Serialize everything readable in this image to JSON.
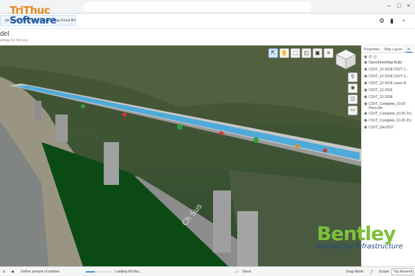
{
  "logo": {
    "line1": "TriThuc",
    "line2": "Software"
  },
  "tab_strip_text": "ple Model   Point Cloud Imagery   Map   Drone   Bridge",
  "page": {
    "title": "del",
    "subtitle": "ettings for this tool"
  },
  "viewport_tools": [
    {
      "icon": "select-icon",
      "glyph": "⇱",
      "active": true
    },
    {
      "icon": "pan-icon",
      "glyph": "✋",
      "active": false
    },
    {
      "icon": "fit-view-icon",
      "glyph": "⬚",
      "active": false
    },
    {
      "icon": "window-area-icon",
      "glyph": "◰",
      "active": false
    },
    {
      "icon": "image-icon",
      "glyph": "▣",
      "active": false
    },
    {
      "icon": "list-icon",
      "glyph": "≡",
      "active": false
    }
  ],
  "side_tools": [
    {
      "icon": "walk-icon",
      "glyph": "⚲"
    },
    {
      "icon": "camera-icon",
      "glyph": "◉"
    },
    {
      "icon": "measure-icon",
      "glyph": "◫"
    },
    {
      "icon": "fullscreen-icon",
      "glyph": "▭"
    }
  ],
  "panel": {
    "tabs": [
      "Properties",
      "Map Layers",
      "M"
    ],
    "layers": [
      "OpenStreetMap Build",
      "CSVT_12-2018 CSVT-1...",
      "CSVT_12-2018 CSVT-1...",
      "CSVT_12-2018 Lower B",
      "CSVT_12-2016",
      "CSVT_12-2018",
      "CSVT_Complete_10-20 Piers-dm",
      "CSVT_Complete_10-20 21c",
      "CSVT_Complete_10-20 21c",
      "CSVT_Dec2017"
    ]
  },
  "status": {
    "help": "Define amount of rotation",
    "loading": "Loading 68 tiles...",
    "views": "Views",
    "snap": "Snap Mode",
    "scope_label": "Scope:",
    "scope_value": "Top Assemb",
    "progress": 0.35
  },
  "watermark": {
    "name": "Bentley",
    "tagline": "Advancing Infrastructure"
  },
  "road_label": "Ch  Sus",
  "colors": {
    "accent": "#1e6bb8",
    "bentley_green": "#7dbf3b",
    "deck_blue": "#39a7e0"
  }
}
